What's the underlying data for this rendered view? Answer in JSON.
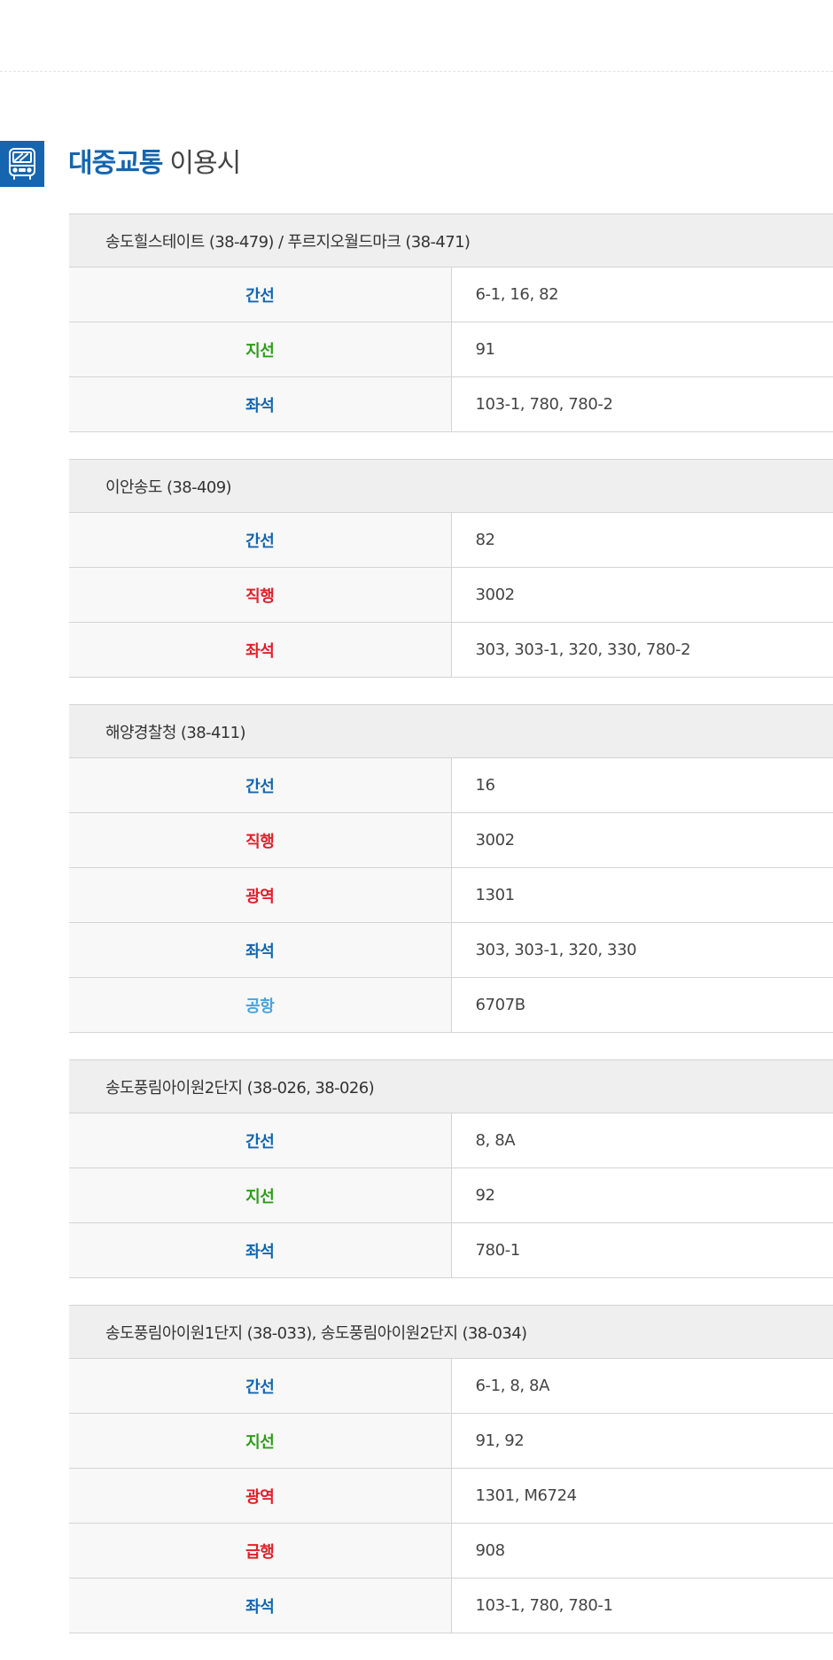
{
  "section": {
    "title_accent": "대중교통",
    "title_rest": "이용시",
    "icon": "bus-icon"
  },
  "colors": {
    "blue": "#1565b0",
    "green": "#2e9c1a",
    "red": "#e0212b",
    "sky": "#4aa3df"
  },
  "stops": [
    {
      "name": "송도힐스테이트 (38-479) / 푸르지오월드마크 (38-471)",
      "rows": [
        {
          "type": "간선",
          "color": "blue",
          "routes": "6-1, 16, 82"
        },
        {
          "type": "지선",
          "color": "green",
          "routes": "91"
        },
        {
          "type": "좌석",
          "color": "blue",
          "routes": "103-1, 780, 780-2"
        }
      ]
    },
    {
      "name": "이안송도 (38-409)",
      "rows": [
        {
          "type": "간선",
          "color": "blue",
          "routes": "82"
        },
        {
          "type": "직행",
          "color": "red",
          "routes": "3002"
        },
        {
          "type": "좌석",
          "color": "red",
          "routes": "303, 303-1, 320, 330, 780-2"
        }
      ]
    },
    {
      "name": "해양경찰청 (38-411)",
      "rows": [
        {
          "type": "간선",
          "color": "blue",
          "routes": "16"
        },
        {
          "type": "직행",
          "color": "red",
          "routes": "3002"
        },
        {
          "type": "광역",
          "color": "red",
          "routes": "1301"
        },
        {
          "type": "좌석",
          "color": "blue",
          "routes": "303, 303-1, 320, 330"
        },
        {
          "type": "공항",
          "color": "sky",
          "routes": "6707B"
        }
      ]
    },
    {
      "name": "송도풍림아이원2단지 (38-026, 38-026)",
      "rows": [
        {
          "type": "간선",
          "color": "blue",
          "routes": "8, 8A"
        },
        {
          "type": "지선",
          "color": "green",
          "routes": "92"
        },
        {
          "type": "좌석",
          "color": "blue",
          "routes": "780-1"
        }
      ]
    },
    {
      "name": "송도풍림아이원1단지 (38-033), 송도풍림아이원2단지 (38-034)",
      "rows": [
        {
          "type": "간선",
          "color": "blue",
          "routes": "6-1, 8, 8A"
        },
        {
          "type": "지선",
          "color": "green",
          "routes": "91, 92"
        },
        {
          "type": "광역",
          "color": "red",
          "routes": "1301, M6724"
        },
        {
          "type": "급행",
          "color": "red",
          "routes": "908"
        },
        {
          "type": "좌석",
          "color": "blue",
          "routes": "103-1, 780, 780-1"
        }
      ]
    }
  ]
}
